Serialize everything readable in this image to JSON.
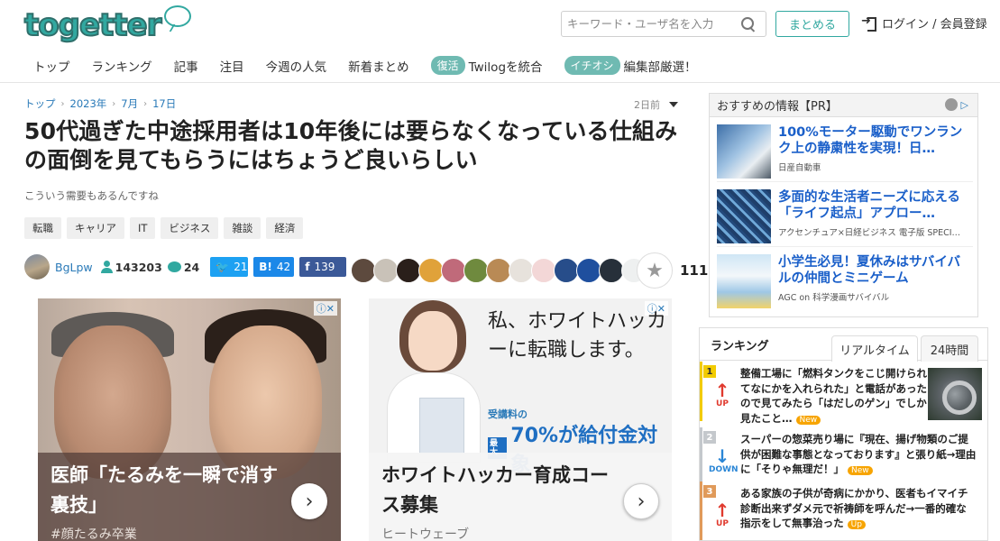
{
  "header": {
    "logo": "togetter",
    "search_placeholder": "キーワード・ユーザ名を入力",
    "summarize_label": "まとめる",
    "login_label": "ログイン / 会員登録"
  },
  "nav": {
    "items": [
      "トップ",
      "ランキング",
      "記事",
      "注目",
      "今週の人気",
      "新着まとめ"
    ],
    "badge1": "復活",
    "badge1_text": "Twilogを統合",
    "badge2": "イチオシ",
    "badge2_text": "編集部厳選！"
  },
  "breadcrumb": [
    "トップ",
    "2023年",
    "7月",
    "17日"
  ],
  "time_ago": "2日前",
  "article": {
    "title": "50代過ぎた中途採用者は10年後には要らなくなっている仕組みの面倒を見てもらうにはちょうど良いらしい",
    "description": "こういう需要もあるんですね",
    "tags": [
      "転職",
      "キャリア",
      "IT",
      "ビジネス",
      "雑談",
      "経済"
    ],
    "user": "BgLpw",
    "views": "143203",
    "comments": "24",
    "twitter_count": "21",
    "hatena_label": "B!",
    "hatena_count": "42",
    "facebook_label": "f",
    "facebook_count": "139",
    "favorites": "111"
  },
  "ads": {
    "ad1": {
      "headline": "医師「たるみを一瞬で消す裏技」",
      "sub": "#顔たるみ卒業"
    },
    "ad2": {
      "hand_text": "私、ホワイトハッカーに転職します。",
      "sub_label": "受講料の",
      "max_label": "最大",
      "promo": "70%が給付金対象",
      "headline": "ホワイトハッカー育成コース募集",
      "sub": "ヒートウェーブ"
    }
  },
  "pr": {
    "heading": "おすすめの情報【PR】",
    "items": [
      {
        "title": "100%モーター駆動でワンランク上の静粛性を実現！日…",
        "sponsor": "日産自動車"
      },
      {
        "title": "多面的な生活者ニーズに応える「ライフ起点」アプロー…",
        "sponsor": "アクセンチュア×日経ビジネス 電子版 SPECI…"
      },
      {
        "title": "小学生必見！夏休みはサバイバルの仲間とミニゲーム",
        "sponsor": "AGC on 科学漫画サバイバル"
      }
    ]
  },
  "ranking": {
    "title": "ランキング",
    "tab_realtime": "リアルタイム",
    "tab_24h": "24時間",
    "rows": [
      {
        "rank": "1",
        "trend": "UP",
        "text": "整備工場に「燃料タンクをこじ開けられてなにかを入れられた」と電話があったので見てみたら「はだしのゲン」でしか見たこと…",
        "badge": "New"
      },
      {
        "rank": "2",
        "trend": "DOWN",
        "text": "スーパーの惣菜売り場に『現在、揚げ物類のご提供が困難な事態となっております』と張り紙→理由に「そりゃ無理だ！」",
        "badge": "New"
      },
      {
        "rank": "3",
        "trend": "UP",
        "text": "ある家族の子供が奇病にかかり、医者もイマイチ診断出来ずダメ元で祈祷師を呼んだ→一番的確な指示をして無事治った",
        "badge": "Up"
      }
    ]
  },
  "colors": {
    "brand": "#31a8a0",
    "link": "#2a7ab8",
    "pr_title": "#1a5fc9",
    "up": "#e03a2e",
    "down": "#2a86d6"
  }
}
